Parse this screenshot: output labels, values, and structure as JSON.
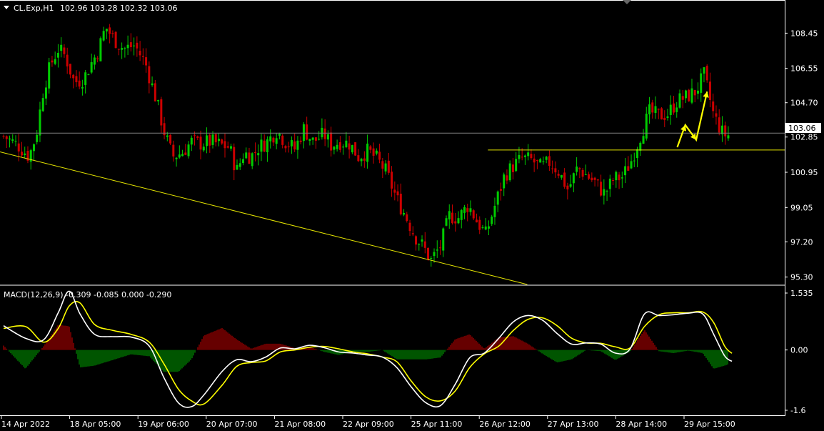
{
  "header": {
    "symbol": "CL.Exp,H1",
    "ohlc": "102.96 103.28 102.32 103.06"
  },
  "macd_header": "MACD(12,26,9) -0.309 -0.085 0.000 -0.290",
  "current_price_label": "103.06",
  "colors": {
    "background": "#000000",
    "up_candle": "#00cc00",
    "down_candle": "#cc0000",
    "frame": "#ffffff",
    "current_price_line": "#808080",
    "support_line": "#e6e600",
    "trend_line": "#e6e600",
    "arrow": "#ffff00",
    "macd_line": "#ffffff",
    "signal_line": "#ffff00",
    "hist_positive": "#cc0000",
    "hist_negative": "#00aa00"
  },
  "chart_data": [
    {
      "type": "candlestick",
      "title": "CL.Exp,H1",
      "y_ticks": [
        "108.45",
        "106.55",
        "104.70",
        "102.85",
        "100.95",
        "99.05",
        "97.20",
        "95.30"
      ],
      "ylim": [
        94.9,
        110.2
      ],
      "current_price": 103.06,
      "support_level": 102.15,
      "trend_line": [
        [
          0,
          102.05
        ],
        [
          0.67,
          94.9
        ]
      ],
      "projection_arrow": [
        [
          0.925,
          102.3
        ],
        [
          0.936,
          103.5
        ],
        [
          0.951,
          102.7
        ],
        [
          0.966,
          105.3
        ]
      ],
      "series": [
        {
          "close_path": [
            [
              0.0,
              102.9
            ],
            [
              0.02,
              102.4
            ],
            [
              0.035,
              101.8
            ],
            [
              0.045,
              103.0
            ],
            [
              0.055,
              105.5
            ],
            [
              0.065,
              106.8
            ],
            [
              0.075,
              107.6
            ],
            [
              0.085,
              107.2
            ],
            [
              0.097,
              105.8
            ],
            [
              0.11,
              106.0
            ],
            [
              0.12,
              106.8
            ],
            [
              0.13,
              107.5
            ],
            [
              0.14,
              108.8
            ],
            [
              0.15,
              108.2
            ],
            [
              0.165,
              107.6
            ],
            [
              0.18,
              107.8
            ],
            [
              0.195,
              106.8
            ],
            [
              0.21,
              104.8
            ],
            [
              0.22,
              103.2
            ],
            [
              0.232,
              101.8
            ],
            [
              0.245,
              102.0
            ],
            [
              0.258,
              102.6
            ],
            [
              0.27,
              102.5
            ],
            [
              0.285,
              102.6
            ],
            [
              0.3,
              102.4
            ],
            [
              0.31,
              102.3
            ],
            [
              0.32,
              101.0
            ],
            [
              0.33,
              102.0
            ],
            [
              0.34,
              101.8
            ],
            [
              0.35,
              102.3
            ],
            [
              0.362,
              102.6
            ],
            [
              0.375,
              103.2
            ],
            [
              0.387,
              102.6
            ],
            [
              0.4,
              102.2
            ],
            [
              0.412,
              103.3
            ],
            [
              0.425,
              102.6
            ],
            [
              0.44,
              103.0
            ],
            [
              0.45,
              102.4
            ],
            [
              0.462,
              102.6
            ],
            [
              0.475,
              102.5
            ],
            [
              0.487,
              101.8
            ],
            [
              0.5,
              102.1
            ],
            [
              0.512,
              101.7
            ],
            [
              0.525,
              101.0
            ],
            [
              0.54,
              99.5
            ],
            [
              0.552,
              98.6
            ],
            [
              0.565,
              97.5
            ],
            [
              0.575,
              97.0
            ],
            [
              0.587,
              96.2
            ],
            [
              0.6,
              97.0
            ],
            [
              0.612,
              98.6
            ],
            [
              0.625,
              98.5
            ],
            [
              0.638,
              99.2
            ],
            [
              0.65,
              98.3
            ],
            [
              0.662,
              97.6
            ],
            [
              0.675,
              99.2
            ],
            [
              0.688,
              100.8
            ],
            [
              0.7,
              101.3
            ],
            [
              0.712,
              101.7
            ],
            [
              0.725,
              101.6
            ],
            [
              0.738,
              101.2
            ],
            [
              0.75,
              101.5
            ],
            [
              0.762,
              101.0
            ],
            [
              0.775,
              100.0
            ],
            [
              0.788,
              101.2
            ],
            [
              0.8,
              100.8
            ],
            [
              0.812,
              100.4
            ],
            [
              0.825,
              99.8
            ],
            [
              0.838,
              100.6
            ],
            [
              0.85,
              100.7
            ],
            [
              0.862,
              101.6
            ],
            [
              0.875,
              103.0
            ],
            [
              0.887,
              104.2
            ],
            [
              0.9,
              104.0
            ],
            [
              0.912,
              104.1
            ],
            [
              0.925,
              104.8
            ],
            [
              0.937,
              105.0
            ],
            [
              0.95,
              105.3
            ],
            [
              0.962,
              106.2
            ],
            [
              0.975,
              104.0
            ],
            [
              0.988,
              103.0
            ],
            [
              1.0,
              102.9
            ],
            [
              1.03,
              102.8
            ],
            [
              1.045,
              103.06
            ]
          ]
        }
      ]
    },
    {
      "type": "macd",
      "title": "MACD(12,26,9)",
      "y_ticks": [
        "1.535",
        "0.00",
        "-1.6"
      ],
      "ylim": [
        -1.65,
        1.6
      ],
      "x_ticks": [
        "14 Apr 2022",
        "18 Apr 05:00",
        "19 Apr 06:00",
        "20 Apr 07:00",
        "21 Apr 08:00",
        "22 Apr 09:00",
        "25 Apr 11:00",
        "26 Apr 12:00",
        "27 Apr 13:00",
        "28 Apr 14:00",
        "29 Apr 15:00"
      ],
      "macd": [
        [
          0.0,
          0.62
        ],
        [
          0.03,
          0.3
        ],
        [
          0.055,
          0.26
        ],
        [
          0.075,
          0.95
        ],
        [
          0.09,
          1.5
        ],
        [
          0.105,
          0.92
        ],
        [
          0.125,
          0.4
        ],
        [
          0.15,
          0.34
        ],
        [
          0.175,
          0.33
        ],
        [
          0.2,
          0.1
        ],
        [
          0.22,
          -0.7
        ],
        [
          0.24,
          -1.35
        ],
        [
          0.258,
          -1.45
        ],
        [
          0.275,
          -1.15
        ],
        [
          0.3,
          -0.55
        ],
        [
          0.32,
          -0.25
        ],
        [
          0.34,
          -0.3
        ],
        [
          0.36,
          -0.18
        ],
        [
          0.38,
          0.05
        ],
        [
          0.4,
          0.03
        ],
        [
          0.42,
          0.12
        ],
        [
          0.44,
          0.06
        ],
        [
          0.46,
          -0.05
        ],
        [
          0.48,
          -0.08
        ],
        [
          0.5,
          -0.13
        ],
        [
          0.52,
          -0.18
        ],
        [
          0.54,
          -0.45
        ],
        [
          0.56,
          -0.95
        ],
        [
          0.58,
          -1.35
        ],
        [
          0.6,
          -1.42
        ],
        [
          0.62,
          -0.88
        ],
        [
          0.64,
          -0.2
        ],
        [
          0.66,
          -0.08
        ],
        [
          0.68,
          0.3
        ],
        [
          0.7,
          0.72
        ],
        [
          0.72,
          0.88
        ],
        [
          0.74,
          0.76
        ],
        [
          0.76,
          0.42
        ],
        [
          0.78,
          0.15
        ],
        [
          0.8,
          0.18
        ],
        [
          0.82,
          0.15
        ],
        [
          0.84,
          -0.08
        ],
        [
          0.86,
          0.02
        ],
        [
          0.88,
          0.92
        ],
        [
          0.9,
          0.88
        ],
        [
          0.92,
          0.9
        ],
        [
          0.94,
          0.94
        ],
        [
          0.96,
          0.92
        ],
        [
          0.975,
          0.4
        ],
        [
          0.99,
          -0.15
        ],
        [
          1.0,
          -0.29
        ]
      ],
      "signal": [
        [
          0.0,
          0.55
        ],
        [
          0.03,
          0.6
        ],
        [
          0.055,
          0.2
        ],
        [
          0.075,
          0.55
        ],
        [
          0.09,
          1.12
        ],
        [
          0.105,
          1.2
        ],
        [
          0.125,
          0.65
        ],
        [
          0.15,
          0.5
        ],
        [
          0.175,
          0.4
        ],
        [
          0.2,
          0.2
        ],
        [
          0.22,
          -0.35
        ],
        [
          0.24,
          -1.0
        ],
        [
          0.258,
          -1.3
        ],
        [
          0.275,
          -1.38
        ],
        [
          0.3,
          -0.9
        ],
        [
          0.32,
          -0.42
        ],
        [
          0.34,
          -0.32
        ],
        [
          0.36,
          -0.28
        ],
        [
          0.38,
          -0.05
        ],
        [
          0.4,
          0.0
        ],
        [
          0.42,
          0.07
        ],
        [
          0.44,
          0.09
        ],
        [
          0.46,
          0.03
        ],
        [
          0.48,
          -0.05
        ],
        [
          0.5,
          -0.1
        ],
        [
          0.52,
          -0.18
        ],
        [
          0.54,
          -0.3
        ],
        [
          0.56,
          -0.8
        ],
        [
          0.58,
          -1.2
        ],
        [
          0.6,
          -1.3
        ],
        [
          0.62,
          -1.05
        ],
        [
          0.64,
          -0.45
        ],
        [
          0.66,
          -0.1
        ],
        [
          0.68,
          0.1
        ],
        [
          0.7,
          0.5
        ],
        [
          0.72,
          0.78
        ],
        [
          0.74,
          0.82
        ],
        [
          0.76,
          0.62
        ],
        [
          0.78,
          0.3
        ],
        [
          0.8,
          0.18
        ],
        [
          0.82,
          0.17
        ],
        [
          0.84,
          0.08
        ],
        [
          0.86,
          0.05
        ],
        [
          0.88,
          0.6
        ],
        [
          0.9,
          0.9
        ],
        [
          0.92,
          0.95
        ],
        [
          0.94,
          0.95
        ],
        [
          0.96,
          0.97
        ],
        [
          0.975,
          0.7
        ],
        [
          0.99,
          0.1
        ],
        [
          1.0,
          -0.085
        ]
      ]
    }
  ]
}
